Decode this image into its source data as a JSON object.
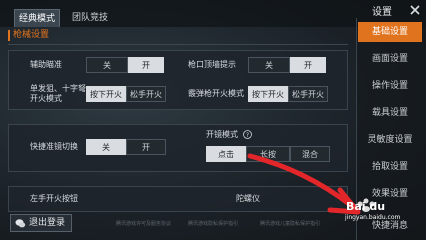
{
  "tabs": [
    "经典模式",
    "团队竞技"
  ],
  "settings_title": "设置",
  "sidebar": [
    "基础设置",
    "画面设置",
    "操作设置",
    "载具设置",
    "灵敏度设置",
    "拾取设置",
    "效果设置",
    "快捷消息"
  ],
  "section_title": "枪械设置",
  "aim_assist": {
    "label": "辅助瞄准",
    "off": "关",
    "on": "开"
  },
  "muzzle_hint": {
    "label": "枪口顶墙提示",
    "off": "关",
    "on": "开"
  },
  "single_fire": {
    "label": "单发狙、十字弩开火模式",
    "opt1": "按下开火",
    "opt2": "松手开火"
  },
  "scope_fire": {
    "label": "霰弹枪开火模式",
    "opt1": "按下开火",
    "opt2": "松手开火"
  },
  "quick_scope": {
    "label": "快捷准镜切换",
    "off": "关",
    "on": "开"
  },
  "scope_mode": {
    "label": "开镜模式",
    "opt1": "点击",
    "opt2": "长按",
    "opt3": "混合"
  },
  "left_fire": {
    "label": "左手开火按钮"
  },
  "gyro": {
    "label": "陀螺仪"
  },
  "logout": "退出登录",
  "footer": [
    "腾讯游戏许可及服务协议",
    "腾讯游戏隐私保护指引",
    "腾讯游戏儿童隐私保护指引"
  ],
  "watermark": {
    "logo": "Bai du",
    "url": "jingyan.baidu.com"
  },
  "colors": {
    "accent": "#e0731e",
    "arrow": "#e3262a"
  }
}
